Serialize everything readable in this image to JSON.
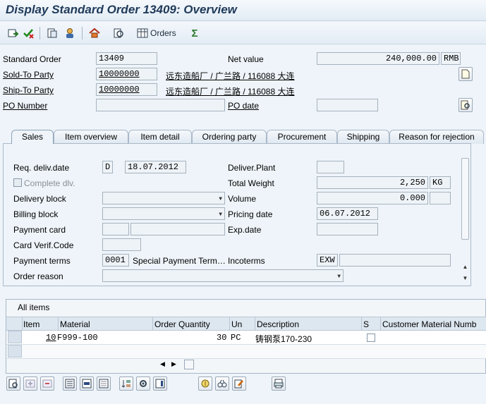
{
  "window": {
    "title": "Display Standard Order 13409: Overview"
  },
  "toolbar": {
    "orders_label": "Orders"
  },
  "header": {
    "standard_order_label": "Standard Order",
    "standard_order_value": "13409",
    "net_value_label": "Net value",
    "net_value_amount": "240,000.00",
    "net_value_currency": "RMB",
    "sold_to_label": "Sold-To Party",
    "sold_to_value": "10000000",
    "sold_to_text": "远东造船厂 / 广兰路 / 116088 大连",
    "ship_to_label": "Ship-To Party",
    "ship_to_value": "10000000",
    "ship_to_text": "远东造船厂 / 广兰路 / 116088 大连",
    "po_number_label": "PO Number",
    "po_number_value": "",
    "po_date_label": "PO date",
    "po_date_value": ""
  },
  "tabs": [
    {
      "label": "Sales"
    },
    {
      "label": "Item overview"
    },
    {
      "label": "Item detail"
    },
    {
      "label": "Ordering party"
    },
    {
      "label": "Procurement"
    },
    {
      "label": "Shipping"
    },
    {
      "label": "Reason for rejection"
    }
  ],
  "sales": {
    "req_deliv_label": "Req. deliv.date",
    "req_deliv_type": "D",
    "req_deliv_date": "18.07.2012",
    "deliver_plant_label": "Deliver.Plant",
    "complete_dlv_label": "Complete dlv.",
    "total_weight_label": "Total Weight",
    "total_weight_value": "2,250",
    "total_weight_unit": "KG",
    "delivery_block_label": "Delivery block",
    "volume_label": "Volume",
    "volume_value": "0.000",
    "billing_block_label": "Billing block",
    "pricing_date_label": "Pricing date",
    "pricing_date_value": "06.07.2012",
    "payment_card_label": "Payment card",
    "exp_date_label": "Exp.date",
    "card_verif_label": "Card Verif.Code",
    "payment_terms_label": "Payment terms",
    "payment_terms_value": "0001",
    "special_payment_label": "Special Payment Term…",
    "incoterms_label": "Incoterms",
    "incoterms_value": "EXW",
    "order_reason_label": "Order reason"
  },
  "items": {
    "title": "All items",
    "columns": [
      "Item",
      "Material",
      "Order Quantity",
      "Un",
      "Description",
      "S",
      "Customer Material Numb"
    ],
    "rows": [
      {
        "item": "10",
        "material": "F999-100",
        "qty": "30",
        "unit": "PC",
        "description": "铸钢泵170-230"
      }
    ]
  }
}
